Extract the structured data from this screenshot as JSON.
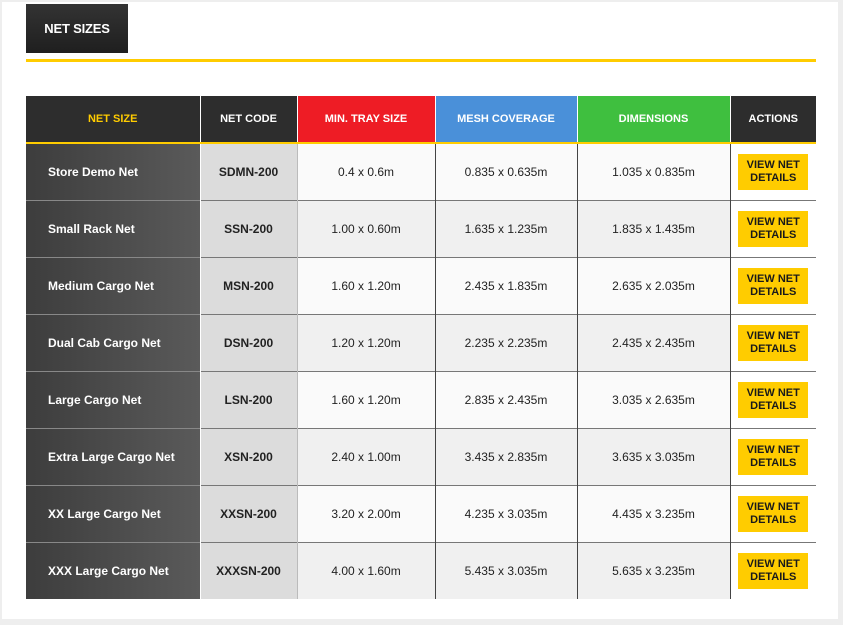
{
  "tab": {
    "label": "NET SIZES"
  },
  "colors": {
    "accent": "#ffcc00",
    "tray_header": "#ee1c25",
    "mesh_header": "#4a90d9",
    "dim_header": "#3fbf3f"
  },
  "table": {
    "headers": {
      "size": "NET SIZE",
      "code": "NET CODE",
      "tray": "MIN. TRAY SIZE",
      "mesh": "MESH COVERAGE",
      "dim": "DIMENSIONS",
      "actions": "ACTIONS"
    },
    "button_label": "VIEW NET DETAILS",
    "rows": [
      {
        "size": "Store Demo Net",
        "code": "SDMN-200",
        "tray": "0.4 x 0.6m",
        "mesh": "0.835 x 0.635m",
        "dim": "1.035 x 0.835m"
      },
      {
        "size": "Small Rack Net",
        "code": "SSN-200",
        "tray": "1.00 x 0.60m",
        "mesh": "1.635 x 1.235m",
        "dim": "1.835 x 1.435m"
      },
      {
        "size": "Medium Cargo Net",
        "code": "MSN-200",
        "tray": "1.60 x 1.20m",
        "mesh": "2.435 x 1.835m",
        "dim": "2.635 x 2.035m"
      },
      {
        "size": "Dual Cab Cargo Net",
        "code": "DSN-200",
        "tray": "1.20 x 1.20m",
        "mesh": "2.235 x 2.235m",
        "dim": "2.435 x 2.435m"
      },
      {
        "size": "Large Cargo Net",
        "code": "LSN-200",
        "tray": "1.60 x 1.20m",
        "mesh": "2.835 x 2.435m",
        "dim": "3.035 x 2.635m"
      },
      {
        "size": "Extra Large Cargo Net",
        "code": "XSN-200",
        "tray": "2.40 x 1.00m",
        "mesh": "3.435 x 2.835m",
        "dim": "3.635 x 3.035m"
      },
      {
        "size": "XX Large Cargo Net",
        "code": "XXSN-200",
        "tray": "3.20 x 2.00m",
        "mesh": "4.235 x 3.035m",
        "dim": "4.435 x 3.235m"
      },
      {
        "size": "XXX Large Cargo Net",
        "code": "XXXSN-200",
        "tray": "4.00 x 1.60m",
        "mesh": "5.435 x 3.035m",
        "dim": "5.635 x 3.235m"
      }
    ]
  }
}
